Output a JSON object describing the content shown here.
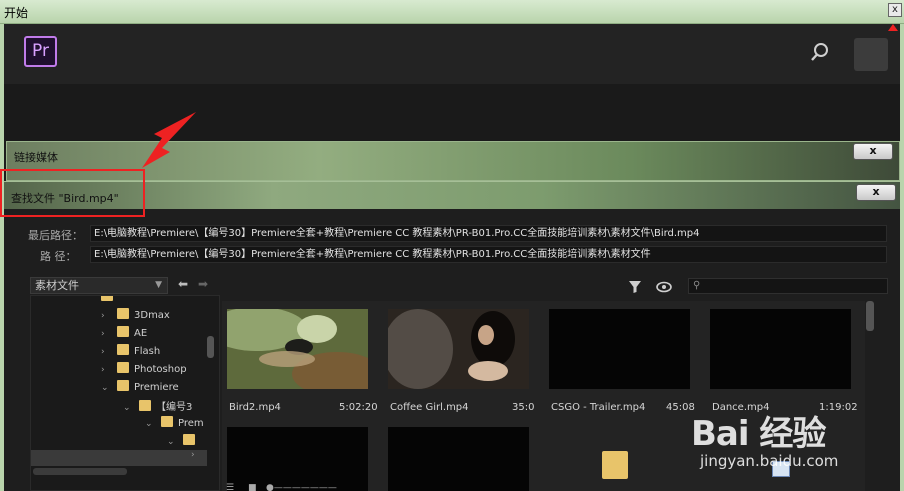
{
  "window": {
    "title": "开始",
    "close_label": "x"
  },
  "premiere": {
    "logo_text": "Pr"
  },
  "link_media_dialog": {
    "title": "链接媒体",
    "close_label": "x"
  },
  "find_dialog": {
    "title": "查找文件 \"Bird.mp4\"",
    "close_label": "x",
    "last_path_label": "最后路径：",
    "last_path_value": "E:\\电脑教程\\Premiere\\【编号30】Premiere全套+教程\\Premiere  CC 教程素材\\PR-B01.Pro.CC全面技能培训素材\\素材文件\\Bird.mp4",
    "path_label": "路 径：",
    "path_value": "E:\\电脑教程\\Premiere\\【编号30】Premiere全套+教程\\Premiere  CC 教程素材\\PR-B01.Pro.CC全面技能培训素材\\素材文件",
    "folder_dropdown": "素材文件",
    "search_placeholder": "",
    "tree": [
      {
        "label": "3Dmax"
      },
      {
        "label": "AE"
      },
      {
        "label": "Flash"
      },
      {
        "label": "Photoshop"
      },
      {
        "label": "Premiere"
      },
      {
        "label": "【编号3"
      },
      {
        "label": "Prem"
      },
      {
        "label": ""
      },
      {
        "label": ""
      }
    ],
    "files": [
      {
        "name": "Bird2.mp4",
        "duration": "5:02:20"
      },
      {
        "name": "Coffee Girl.mp4",
        "duration": "35:0"
      },
      {
        "name": "CSGO - Trailer.mp4",
        "duration": "45:08"
      },
      {
        "name": "Dance.mp4",
        "duration": "1:19:02"
      }
    ]
  },
  "watermark": {
    "line1": "Bai 经验",
    "line2": "jingyan.baidu.com"
  },
  "colors": {
    "accent_pr": "#c07bea",
    "annotation": "#ee2222",
    "folder": "#e8c46a"
  }
}
